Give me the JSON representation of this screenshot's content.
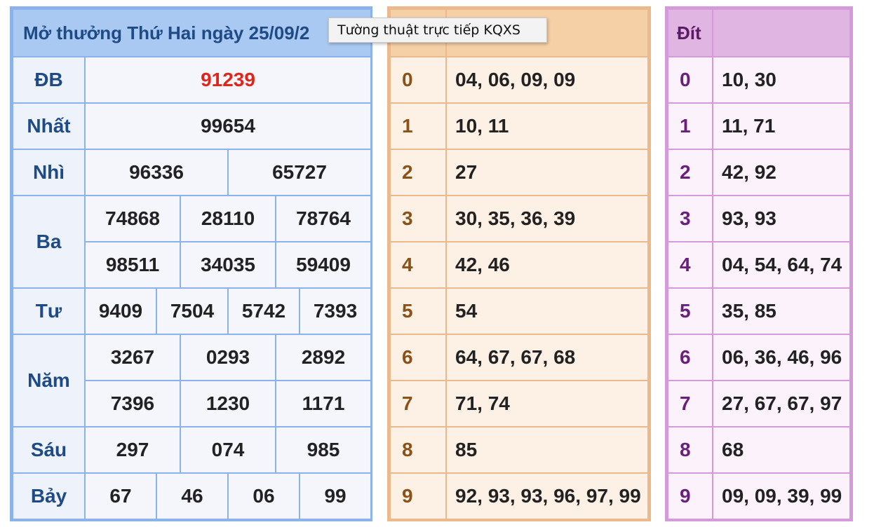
{
  "results": {
    "title": "Mở thưởng Thứ Hai ngày 25/09/2",
    "prizes": {
      "db": {
        "label": "ĐB",
        "numbers": [
          "91239"
        ]
      },
      "nhat": {
        "label": "Nhất",
        "numbers": [
          "99654"
        ]
      },
      "nhi": {
        "label": "Nhì",
        "numbers": [
          "96336",
          "65727"
        ]
      },
      "ba": {
        "label": "Ba",
        "numbers": [
          "74868",
          "28110",
          "78764",
          "98511",
          "34035",
          "59409"
        ]
      },
      "tu": {
        "label": "Tư",
        "numbers": [
          "9409",
          "7504",
          "5742",
          "7393"
        ]
      },
      "nam": {
        "label": "Năm",
        "numbers": [
          "3267",
          "0293",
          "2892",
          "7396",
          "1230",
          "1171"
        ]
      },
      "sau": {
        "label": "Sáu",
        "numbers": [
          "297",
          "074",
          "985"
        ]
      },
      "bay": {
        "label": "Bảy",
        "numbers": [
          "67",
          "46",
          "06",
          "99"
        ]
      }
    }
  },
  "heads": {
    "header": "",
    "rows": [
      {
        "digit": "0",
        "values": "04, 06, 09, 09"
      },
      {
        "digit": "1",
        "values": "10, 11"
      },
      {
        "digit": "2",
        "values": "27"
      },
      {
        "digit": "3",
        "values": "30, 35, 36, 39"
      },
      {
        "digit": "4",
        "values": "42, 46"
      },
      {
        "digit": "5",
        "values": "54"
      },
      {
        "digit": "6",
        "values": "64, 67, 67, 68"
      },
      {
        "digit": "7",
        "values": "71, 74"
      },
      {
        "digit": "8",
        "values": "85"
      },
      {
        "digit": "9",
        "values": "92, 93, 93, 96, 97, 99"
      }
    ]
  },
  "tails": {
    "header": "Đít",
    "rows": [
      {
        "digit": "0",
        "values": "10, 30"
      },
      {
        "digit": "1",
        "values": "11, 71"
      },
      {
        "digit": "2",
        "values": "42, 92"
      },
      {
        "digit": "3",
        "values": "93, 93"
      },
      {
        "digit": "4",
        "values": "04, 54, 64, 74"
      },
      {
        "digit": "5",
        "values": "35, 85"
      },
      {
        "digit": "6",
        "values": "06, 36, 46, 96"
      },
      {
        "digit": "7",
        "values": "27, 67, 67, 97"
      },
      {
        "digit": "8",
        "values": "68"
      },
      {
        "digit": "9",
        "values": "09, 09, 39, 99"
      }
    ]
  },
  "tooltip": {
    "text": "Tường thuật trực tiếp KQXS"
  },
  "colors": {
    "special_prize": "#e0261b",
    "results_accent": "#8bb2ea",
    "heads_accent": "#ebb98c",
    "tails_accent": "#d59ad9"
  }
}
